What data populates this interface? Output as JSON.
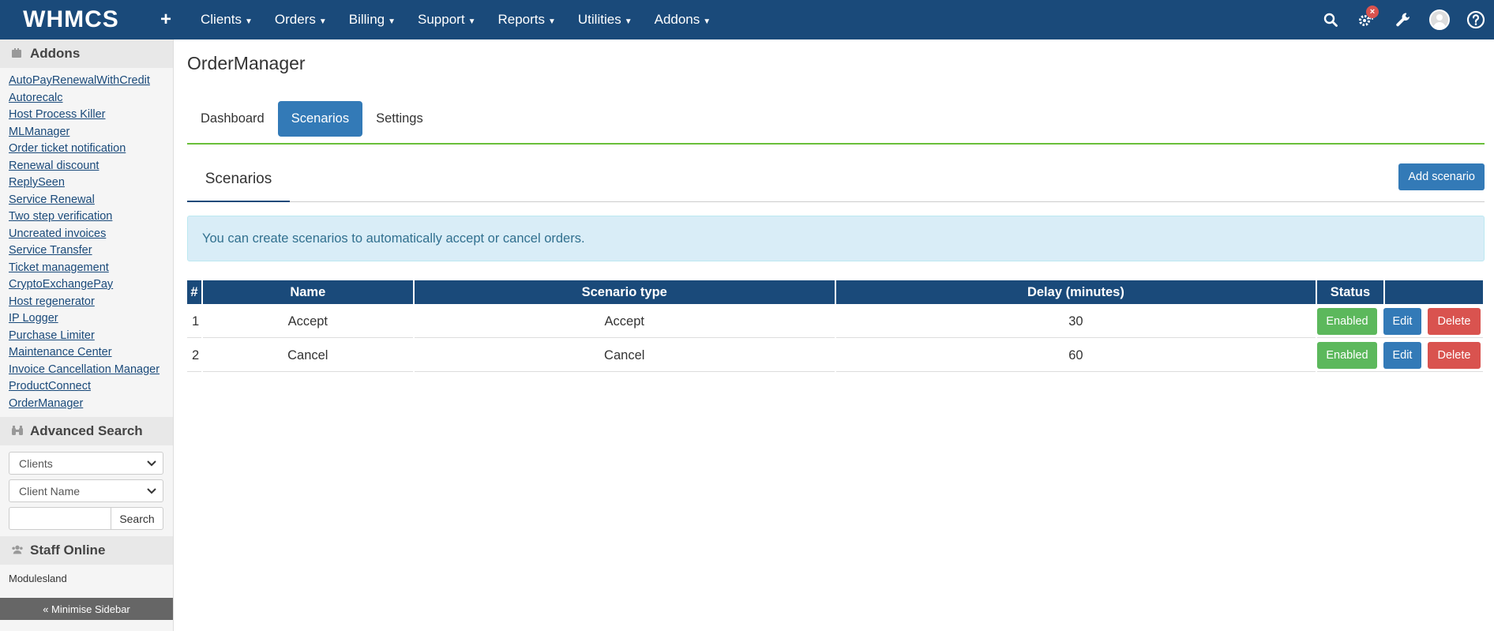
{
  "nav": {
    "logo": "WHMCS",
    "plus": "+",
    "menu": [
      "Clients",
      "Orders",
      "Billing",
      "Support",
      "Reports",
      "Utilities",
      "Addons"
    ],
    "badge": "×"
  },
  "sidebar": {
    "addons_title": "Addons",
    "addons": [
      "AutoPayRenewalWithCredit",
      "Autorecalc",
      "Host Process Killer",
      "MLManager",
      "Order ticket notification",
      "Renewal discount",
      "ReplySeen",
      "Service Renewal",
      "Two step verification",
      "Uncreated invoices",
      "Service Transfer",
      "Ticket management",
      "CryptoExchangePay",
      "Host regenerator",
      "IP Logger",
      "Purchase Limiter",
      "Maintenance Center",
      "Invoice Cancellation Manager",
      "ProductConnect",
      "OrderManager"
    ],
    "search_title": "Advanced Search",
    "select_type": "Clients",
    "select_field": "Client Name",
    "search_value": "",
    "search_button": "Search",
    "staff_title": "Staff Online",
    "staff_name": "Modulesland",
    "minimise": "« Minimise Sidebar"
  },
  "main": {
    "title": "OrderManager",
    "tabs": [
      "Dashboard",
      "Scenarios",
      "Settings"
    ],
    "active_tab": "Scenarios",
    "section_title": "Scenarios",
    "add_button": "Add scenario",
    "alert": "You can create scenarios to automatically accept or cancel orders.",
    "table": {
      "headers": [
        "#",
        "Name",
        "Scenario type",
        "Delay (minutes)",
        "Status",
        ""
      ],
      "rows": [
        {
          "num": "1",
          "name": "Accept",
          "type": "Accept",
          "delay": "30",
          "status": "Enabled",
          "edit": "Edit",
          "delete": "Delete"
        },
        {
          "num": "2",
          "name": "Cancel",
          "type": "Cancel",
          "delay": "60",
          "status": "Enabled",
          "edit": "Edit",
          "delete": "Delete"
        }
      ]
    }
  },
  "colors": {
    "navbar": "#1a4a7a",
    "accent_green": "#6abf3a",
    "primary": "#337ab7",
    "success": "#5cb85c",
    "danger": "#d9534f",
    "info_bg": "#d9edf7"
  }
}
